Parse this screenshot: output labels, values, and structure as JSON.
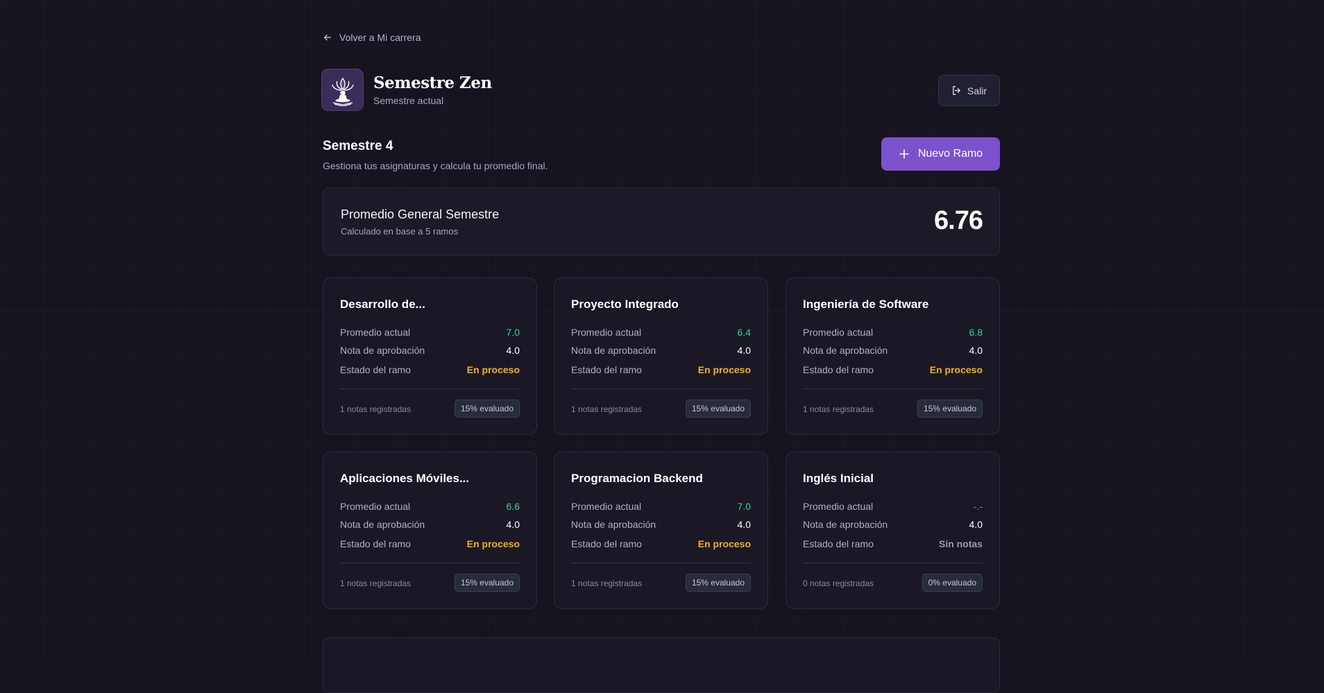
{
  "nav": {
    "back_label": "Volver a Mi carrera"
  },
  "brand": {
    "title": "Semestre Zen",
    "subtitle": "Semestre actual",
    "logo_icon": "lotus-meditation-icon"
  },
  "header": {
    "logout_label": "Salir",
    "logout_icon": "logout-icon"
  },
  "semester": {
    "title": "Semestre 4",
    "subtitle": "Gestiona tus asignaturas y calcula tu promedio final.",
    "new_button_label": "Nuevo Ramo"
  },
  "average": {
    "title": "Promedio General Semestre",
    "subtitle": "Calculado en base a 5 ramos",
    "value": "6.76"
  },
  "labels": {
    "current_avg": "Promedio actual",
    "pass_grade": "Nota de aprobación",
    "status": "Estado del ramo"
  },
  "courses": [
    {
      "name": "Desarrollo de...",
      "avg": "7.0",
      "pass": "4.0",
      "status": "En proceso",
      "notes": "1 notas registradas",
      "evaluated": "15% evaluado"
    },
    {
      "name": "Proyecto Integrado",
      "avg": "6.4",
      "pass": "4.0",
      "status": "En proceso",
      "notes": "1 notas registradas",
      "evaluated": "15% evaluado"
    },
    {
      "name": "Ingeniería de Software",
      "avg": "6.8",
      "pass": "4.0",
      "status": "En proceso",
      "notes": "1 notas registradas",
      "evaluated": "15% evaluado"
    },
    {
      "name": "Aplicaciones Móviles...",
      "avg": "6.6",
      "pass": "4.0",
      "status": "En proceso",
      "notes": "1 notas registradas",
      "evaluated": "15% evaluado"
    },
    {
      "name": "Programacion Backend",
      "avg": "7.0",
      "pass": "4.0",
      "status": "En proceso",
      "notes": "1 notas registradas",
      "evaluated": "15% evaluado"
    },
    {
      "name": "Inglés Inicial",
      "avg": "-.-",
      "pass": "4.0",
      "status": "Sin notas",
      "notes": "0 notas registradas",
      "evaluated": "0% evaluado"
    }
  ],
  "colors": {
    "accent": "#7b52cc",
    "grade_good": "#34d399",
    "status_in_progress": "#f5b017",
    "background": "#16141f"
  }
}
